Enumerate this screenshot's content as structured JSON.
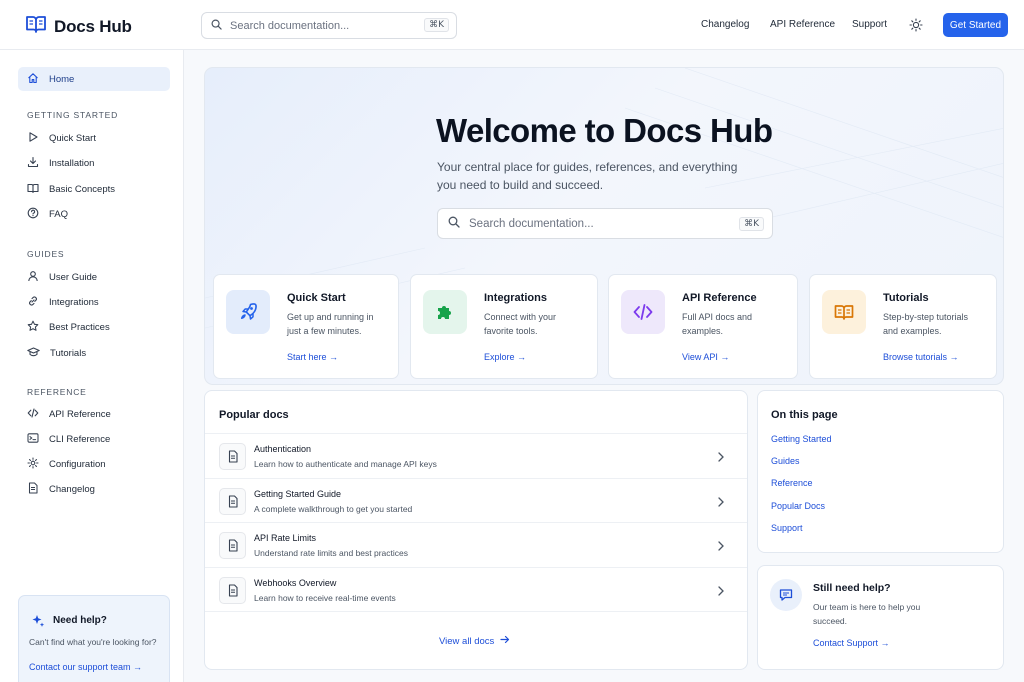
{
  "app": {
    "name": "Docs Hub"
  },
  "header": {
    "search_placeholder": "Search documentation...",
    "search_shortcut": "⌘K",
    "nav": [
      "Changelog",
      "API Reference",
      "Support"
    ],
    "cta": "Get Started"
  },
  "sidebar": {
    "home": "Home",
    "sections": [
      {
        "title": "GETTING STARTED",
        "items": [
          "Quick Start",
          "Installation",
          "Basic Concepts",
          "FAQ"
        ]
      },
      {
        "title": "GUIDES",
        "items": [
          "User Guide",
          "Integrations",
          "Best Practices",
          "Tutorials"
        ]
      },
      {
        "title": "REFERENCE",
        "items": [
          "API Reference",
          "CLI Reference",
          "Configuration",
          "Changelog"
        ]
      }
    ],
    "help": {
      "title": "Need help?",
      "text": "Can't find what you're looking for?",
      "link": "Contact our support team →"
    }
  },
  "hero": {
    "title": "Welcome to Docs Hub",
    "subtitle": "Your central place for guides, references, and everything you need to build and succeed.",
    "search_placeholder": "Search documentation...",
    "search_shortcut": "⌘K"
  },
  "cards": [
    {
      "title": "Quick Start",
      "desc": "Get up and running in just a few minutes.",
      "link": "Start here →",
      "icon": "rocket-icon",
      "bg": "#e3ecfb",
      "fg": "#2563eb"
    },
    {
      "title": "Integrations",
      "desc": "Connect with your favorite tools.",
      "link": "Explore →",
      "icon": "puzzle-icon",
      "bg": "#e4f5ec",
      "fg": "#16a34a"
    },
    {
      "title": "API Reference",
      "desc": "Full API docs and examples.",
      "link": "View API →",
      "icon": "code-icon",
      "bg": "#eee8fb",
      "fg": "#7c3aed"
    },
    {
      "title": "Tutorials",
      "desc": "Step-by-step tutorials and examples.",
      "link": "Browse tutorials →",
      "icon": "book-icon",
      "bg": "#fdf1dc",
      "fg": "#d97706"
    }
  ],
  "popular": {
    "title": "Popular docs",
    "items": [
      {
        "title": "Authentication",
        "desc": "Learn how to authenticate and manage API keys"
      },
      {
        "title": "Getting Started Guide",
        "desc": "A complete walkthrough to get you started"
      },
      {
        "title": "API Rate Limits",
        "desc": "Understand rate limits and best practices"
      },
      {
        "title": "Webhooks Overview",
        "desc": "Learn how to receive real-time events"
      }
    ],
    "view_all": "View all docs"
  },
  "on_this_page": {
    "title": "On this page",
    "links": [
      "Getting Started",
      "Guides",
      "Reference",
      "Popular Docs",
      "Support"
    ]
  },
  "support_card": {
    "title": "Still need help?",
    "text": "Our team is here to help you succeed.",
    "link": "Contact Support →"
  },
  "colors": {
    "accent": "#2563eb",
    "link": "#1d4ed8"
  }
}
